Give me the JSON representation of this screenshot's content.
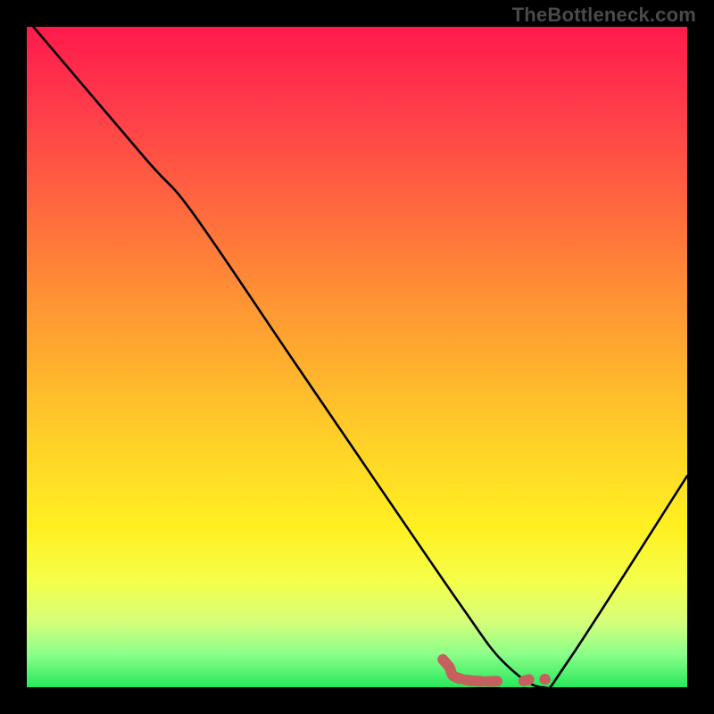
{
  "watermark": "TheBottleneck.com",
  "chart_data": {
    "type": "line",
    "title": "",
    "xlabel": "",
    "ylabel": "",
    "xlim": [
      0,
      100
    ],
    "ylim": [
      0,
      100
    ],
    "grid": false,
    "series": [
      {
        "name": "bottleneck-curve",
        "color": "#000000",
        "x": [
          1,
          18,
          25,
          40,
          55,
          66,
          72,
          78,
          82,
          100
        ],
        "values": [
          100,
          80,
          72,
          50,
          28,
          12,
          4,
          0,
          4,
          32
        ]
      },
      {
        "name": "optimal-zone-marker",
        "color": "#c6605f",
        "x": [
          63,
          64,
          64.5,
          66,
          68.5,
          71,
          73,
          75,
          77,
          78.5
        ],
        "values": [
          4.2,
          3.0,
          1.8,
          1.2,
          0.9,
          0.9,
          1.0,
          0.9,
          1.4,
          1.2
        ]
      }
    ],
    "background_gradient": [
      {
        "stop": 0,
        "color": "#ff1a4d"
      },
      {
        "stop": 12,
        "color": "#ff3b4a"
      },
      {
        "stop": 28,
        "color": "#ff6a3e"
      },
      {
        "stop": 40,
        "color": "#ff8f35"
      },
      {
        "stop": 52,
        "color": "#ffb22d"
      },
      {
        "stop": 64,
        "color": "#ffd427"
      },
      {
        "stop": 76,
        "color": "#fff022"
      },
      {
        "stop": 84,
        "color": "#f4ff4a"
      },
      {
        "stop": 90,
        "color": "#d6ff7a"
      },
      {
        "stop": 95,
        "color": "#8bff8a"
      },
      {
        "stop": 100,
        "color": "#27e85b"
      }
    ]
  }
}
